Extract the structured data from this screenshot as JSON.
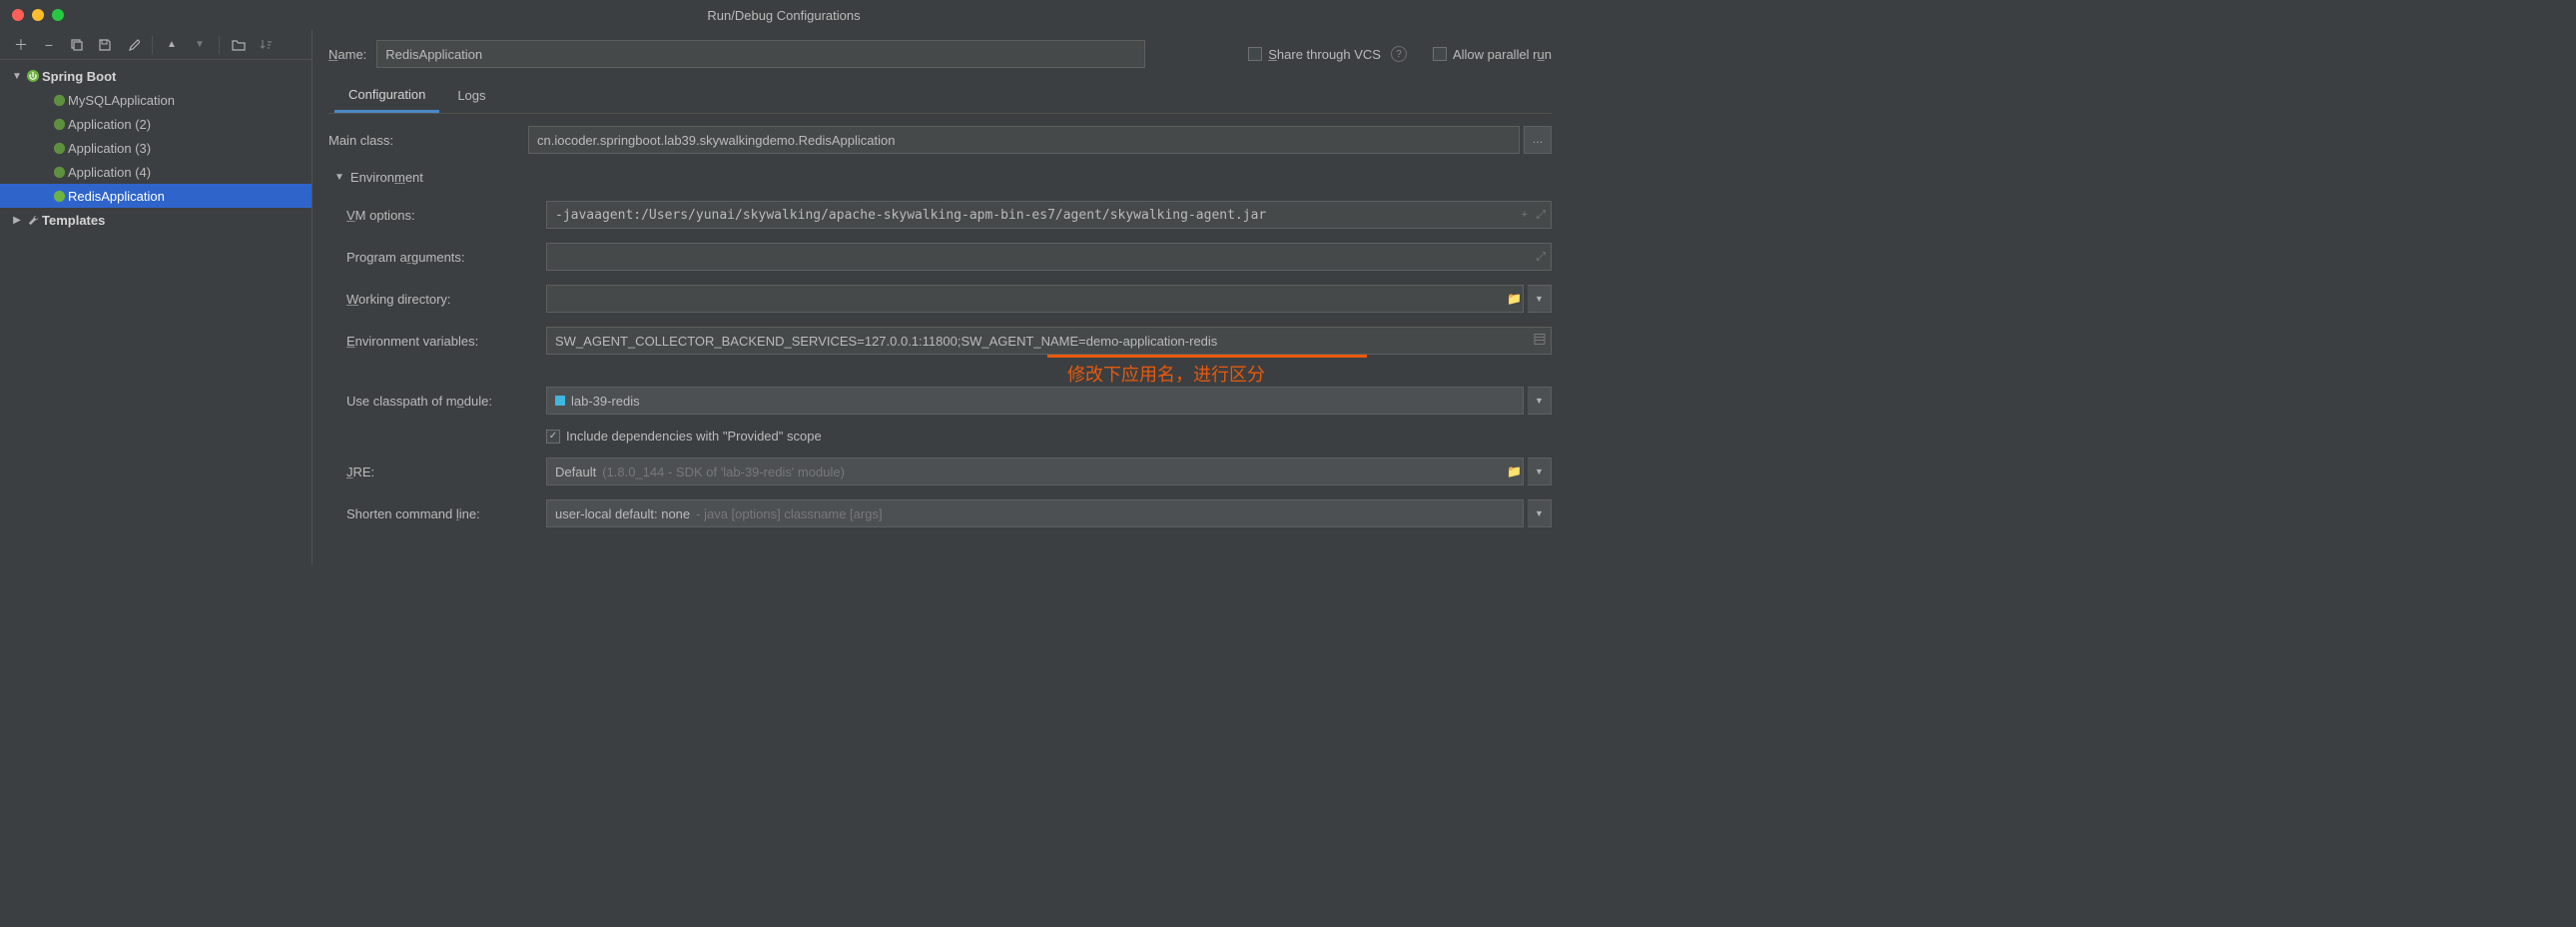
{
  "window": {
    "title": "Run/Debug Configurations"
  },
  "toolbar": {
    "add": "+",
    "remove": "−",
    "copy": "⎘",
    "save": "💾",
    "wrench": "🔧",
    "up": "▲",
    "down": "▼",
    "folder": "📁",
    "sort": "↓ª"
  },
  "tree": {
    "spring_boot": "Spring Boot",
    "items": [
      {
        "label": "MySQLApplication"
      },
      {
        "label": "Application (2)"
      },
      {
        "label": "Application (3)"
      },
      {
        "label": "Application (4)"
      },
      {
        "label": "RedisApplication"
      }
    ],
    "templates": "Templates"
  },
  "header": {
    "name_label": "Name:",
    "name_value": "RedisApplication",
    "share_vcs": "Share through VCS",
    "allow_parallel": "Allow parallel run"
  },
  "tabs": {
    "configuration": "Configuration",
    "logs": "Logs"
  },
  "form": {
    "main_class_label": "Main class:",
    "main_class_value": "cn.iocoder.springboot.lab39.skywalkingdemo.RedisApplication",
    "env_header": "Environment",
    "vm_label": "VM options:",
    "vm_value": "-javaagent:/Users/yunai/skywalking/apache-skywalking-apm-bin-es7/agent/skywalking-agent.jar",
    "prog_args_label": "Program arguments:",
    "prog_args_value": "",
    "working_dir_label": "Working directory:",
    "working_dir_value": "",
    "env_vars_label": "Environment variables:",
    "env_vars_value": "SW_AGENT_COLLECTOR_BACKEND_SERVICES=127.0.0.1:11800;SW_AGENT_NAME=demo-application-redis",
    "classpath_label": "Use classpath of module:",
    "classpath_value": "lab-39-redis",
    "include_provided": "Include dependencies with \"Provided\" scope",
    "jre_label": "JRE:",
    "jre_value": "Default",
    "jre_secondary": "(1.8.0_144 - SDK of 'lab-39-redis' module)",
    "shorten_label": "Shorten command line:",
    "shorten_value": "user-local default: none",
    "shorten_secondary": " - java [options] classname [args]"
  },
  "annotation": {
    "text": "修改下应用名，进行区分"
  }
}
